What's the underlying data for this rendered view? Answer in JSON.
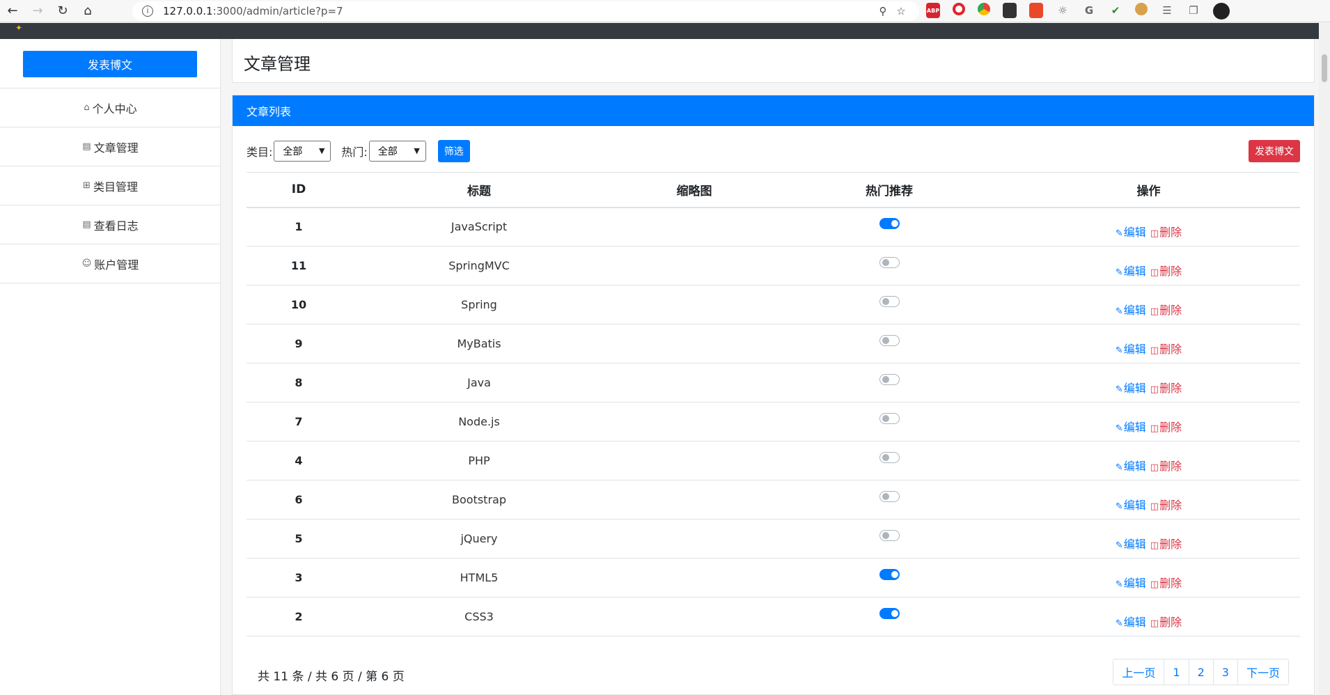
{
  "browser": {
    "url_host": "127.0.0.1",
    "url_path": ":3000/admin/article?p=7"
  },
  "sidebar": {
    "publish_label": "发表博文",
    "items": [
      {
        "label": "个人中心",
        "icon": "home-icon"
      },
      {
        "label": "文章管理",
        "icon": "document-icon"
      },
      {
        "label": "类目管理",
        "icon": "grid-icon"
      },
      {
        "label": "查看日志",
        "icon": "log-icon"
      },
      {
        "label": "账户管理",
        "icon": "user-icon"
      }
    ]
  },
  "header": {
    "title": "文章管理"
  },
  "card": {
    "title": "文章列表",
    "filter": {
      "category_label": "类目:",
      "category_value": "全部",
      "hot_label": "热门:",
      "hot_value": "全部",
      "filter_button": "筛选"
    },
    "new_button": "发表博文",
    "columns": [
      "ID",
      "标题",
      "缩略图",
      "热门推荐",
      "操作"
    ],
    "rows": [
      {
        "id": "1",
        "title": "JavaScript",
        "hot": true
      },
      {
        "id": "11",
        "title": "SpringMVC",
        "hot": false
      },
      {
        "id": "10",
        "title": "Spring",
        "hot": false
      },
      {
        "id": "9",
        "title": "MyBatis",
        "hot": false
      },
      {
        "id": "8",
        "title": "Java",
        "hot": false
      },
      {
        "id": "7",
        "title": "Node.js",
        "hot": false
      },
      {
        "id": "4",
        "title": "PHP",
        "hot": false
      },
      {
        "id": "6",
        "title": "Bootstrap",
        "hot": false
      },
      {
        "id": "5",
        "title": "jQuery",
        "hot": false
      },
      {
        "id": "3",
        "title": "HTML5",
        "hot": true
      },
      {
        "id": "2",
        "title": "CSS3",
        "hot": true
      }
    ],
    "edit_label": "编辑",
    "delete_label": "删除"
  },
  "pagination": {
    "info": "共 11 条 / 共 6 页 / 第 6 页",
    "prev": "上一页",
    "pages": [
      "1",
      "2",
      "3"
    ],
    "next": "下一页"
  },
  "colors": {
    "primary": "#007bff",
    "danger": "#dc3545",
    "topbar": "#343a40"
  }
}
